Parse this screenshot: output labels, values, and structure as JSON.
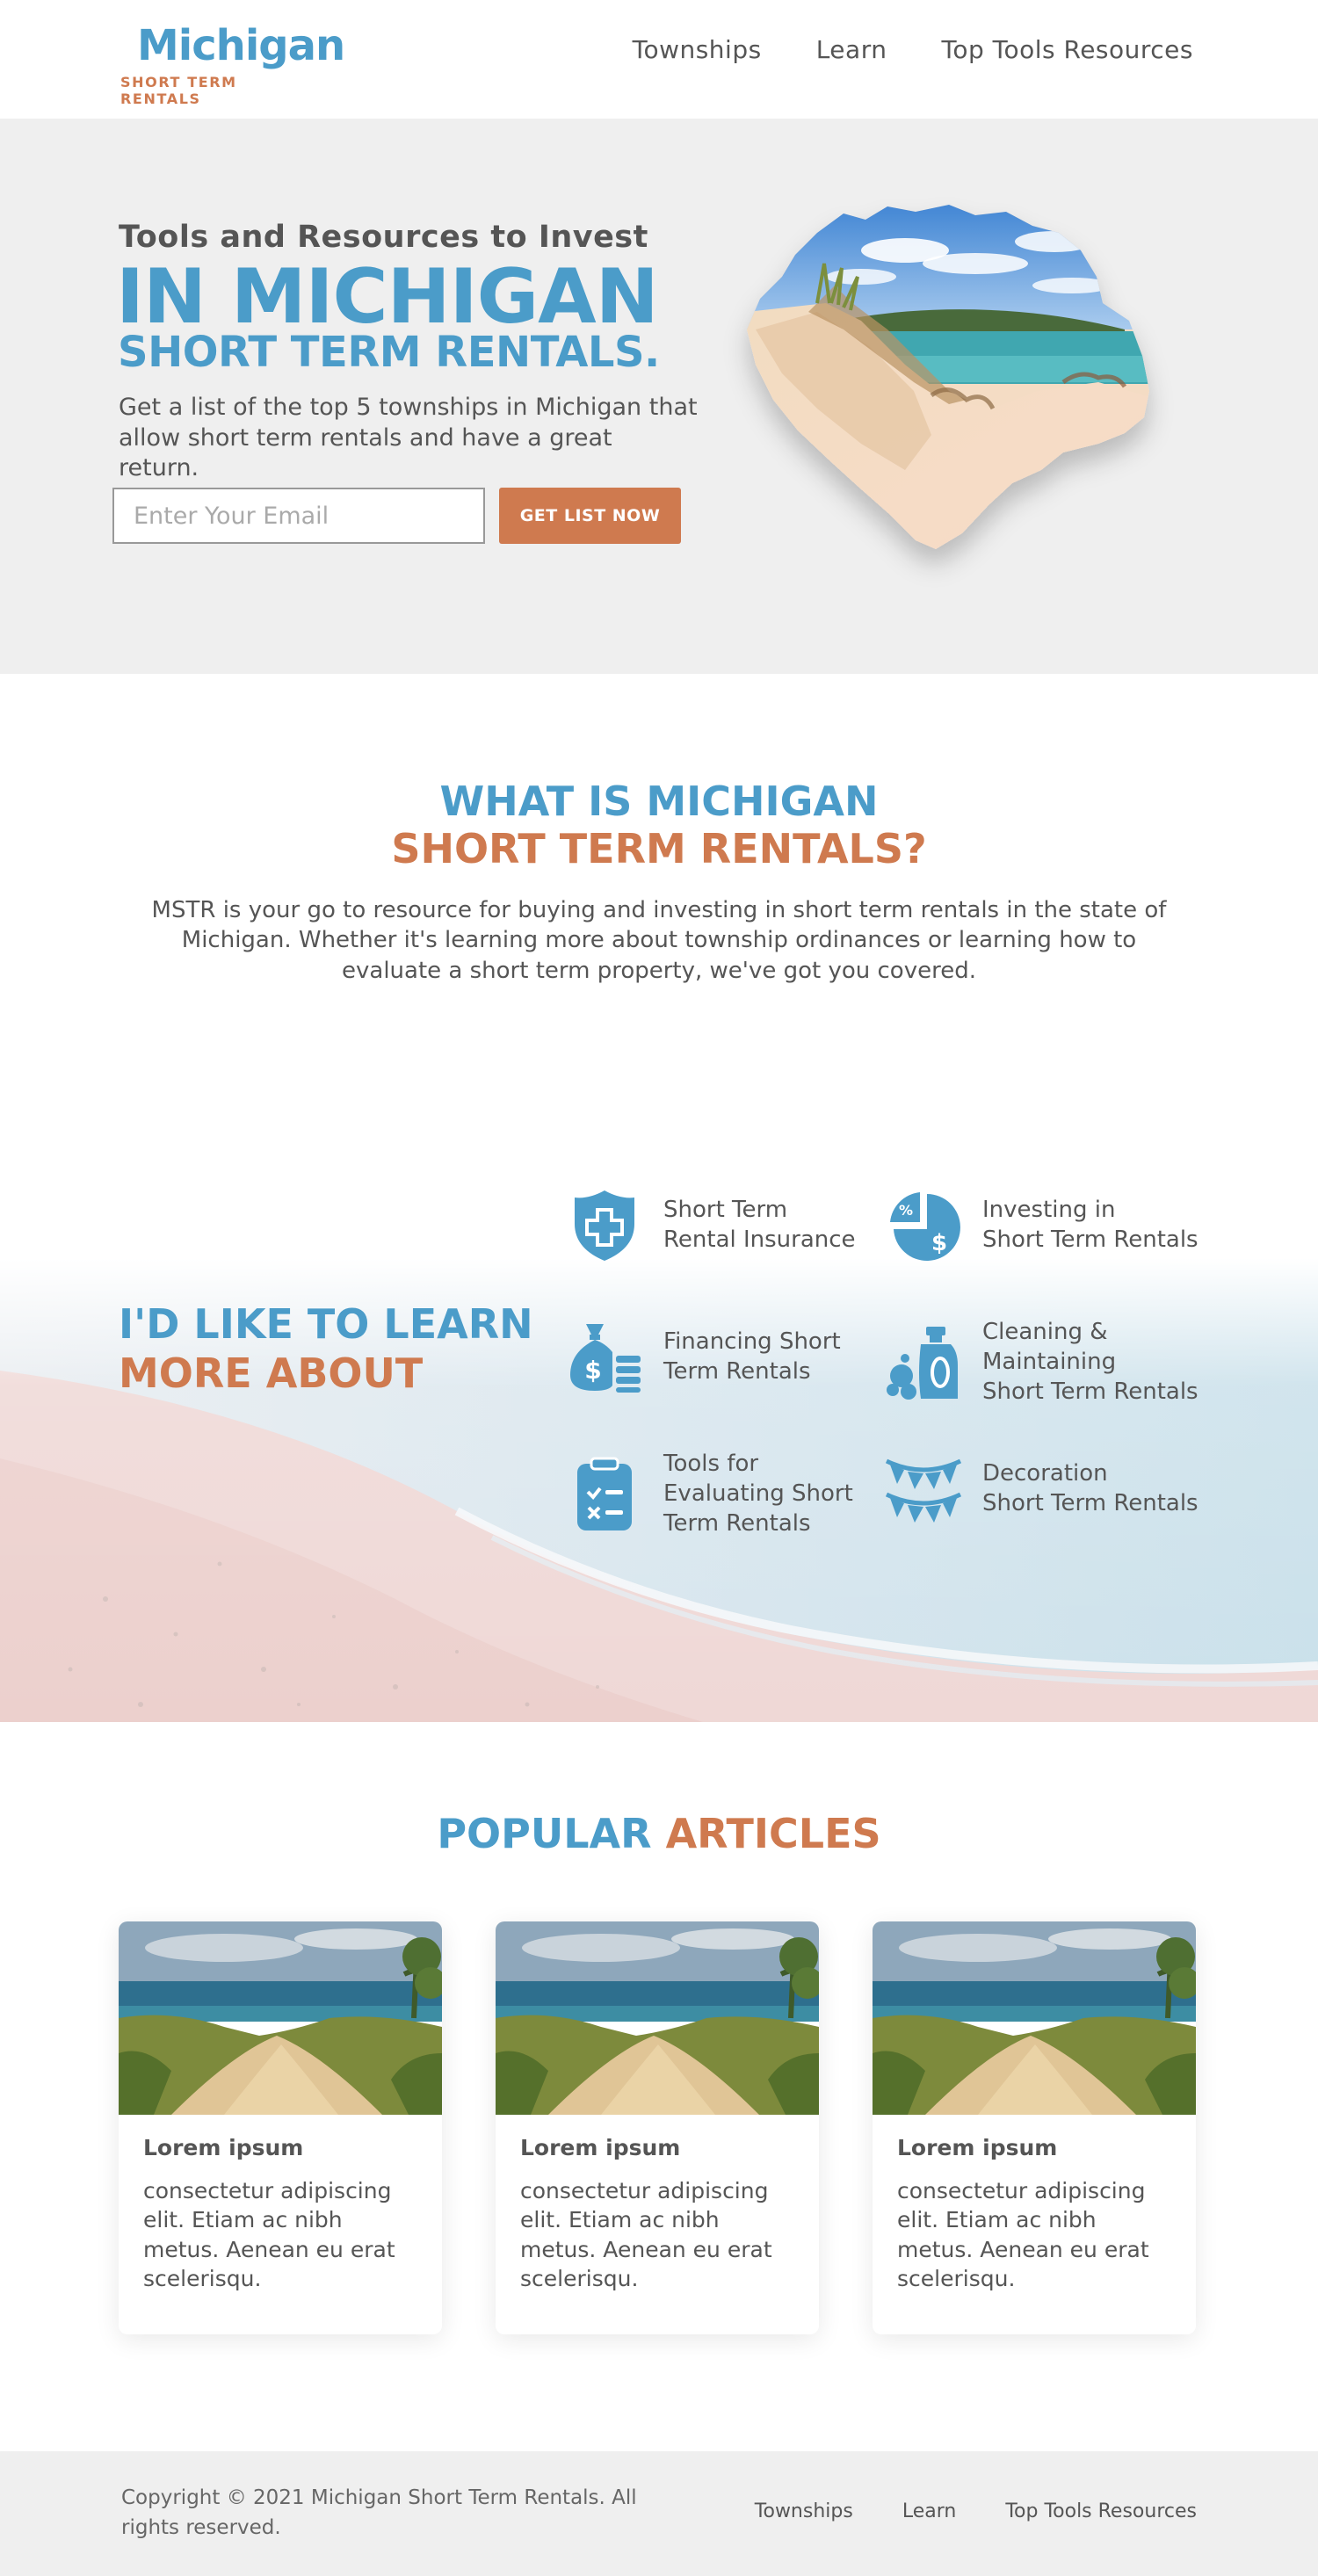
{
  "header": {
    "logo_main": "Michigan",
    "logo_sub": "SHORT TERM RENTALS",
    "nav": [
      "Townships",
      "Learn",
      "Top Tools Resources"
    ]
  },
  "hero": {
    "kicker": "Tools and Resources to Invest",
    "title_line1": "IN MICHIGAN",
    "title_line2": "SHORT TERM RENTALS.",
    "description": "Get a list of the top 5 townships in Michigan that allow short term rentals and have a great return.",
    "email_placeholder": "Enter Your Email",
    "email_value": "",
    "cta_label": "GET LIST NOW"
  },
  "about": {
    "title_line1": "WHAT IS MICHIGAN",
    "title_line2": "SHORT TERM RENTALS?",
    "text": "MSTR is your go to resource for buying and investing in short term rentals in the state of Michigan. Whether it's learning more about township ordinances or learning how to evaluate a short term property, we've got you covered."
  },
  "learn": {
    "title_line1": "I'D LIKE TO LEARN",
    "title_line2": "MORE ABOUT",
    "topics": [
      {
        "label": "Short Term\nRental Insurance",
        "icon": "shield-plus-icon"
      },
      {
        "label": "Investing in\nShort Term Rentals",
        "icon": "pie-dollar-icon"
      },
      {
        "label": "Financing Short\nTerm Rentals",
        "icon": "money-bag-icon"
      },
      {
        "label": "Cleaning &\nMaintaining\nShort Term Rentals",
        "icon": "cleaning-spray-icon"
      },
      {
        "label": "Tools for\nEvaluating Short\nTerm Rentals",
        "icon": "clipboard-checklist-icon"
      },
      {
        "label": "Decoration\nShort Term Rentals",
        "icon": "bunting-icon"
      }
    ]
  },
  "articles": {
    "title_blue": "POPULAR",
    "title_orange": "ARTICLES",
    "items": [
      {
        "title": "Lorem ipsum",
        "text": "consectetur adipiscing elit. Etiam ac nibh metus. Aenean eu erat scelerisqu."
      },
      {
        "title": "Lorem ipsum",
        "text": "consectetur adipiscing elit. Etiam ac nibh metus. Aenean eu erat scelerisqu."
      },
      {
        "title": "Lorem ipsum",
        "text": "consectetur adipiscing elit. Etiam ac nibh metus. Aenean eu erat scelerisqu."
      }
    ]
  },
  "footer": {
    "copyright": "Copyright © 2021 Michigan Short Term Rentals. All rights reserved.",
    "nav": [
      "Townships",
      "Learn",
      "Top Tools Resources"
    ]
  },
  "colors": {
    "brand_blue": "#4b9cc9",
    "brand_orange": "#cf7a4f",
    "text_gray": "#555555",
    "hero_bg": "#efefef"
  }
}
